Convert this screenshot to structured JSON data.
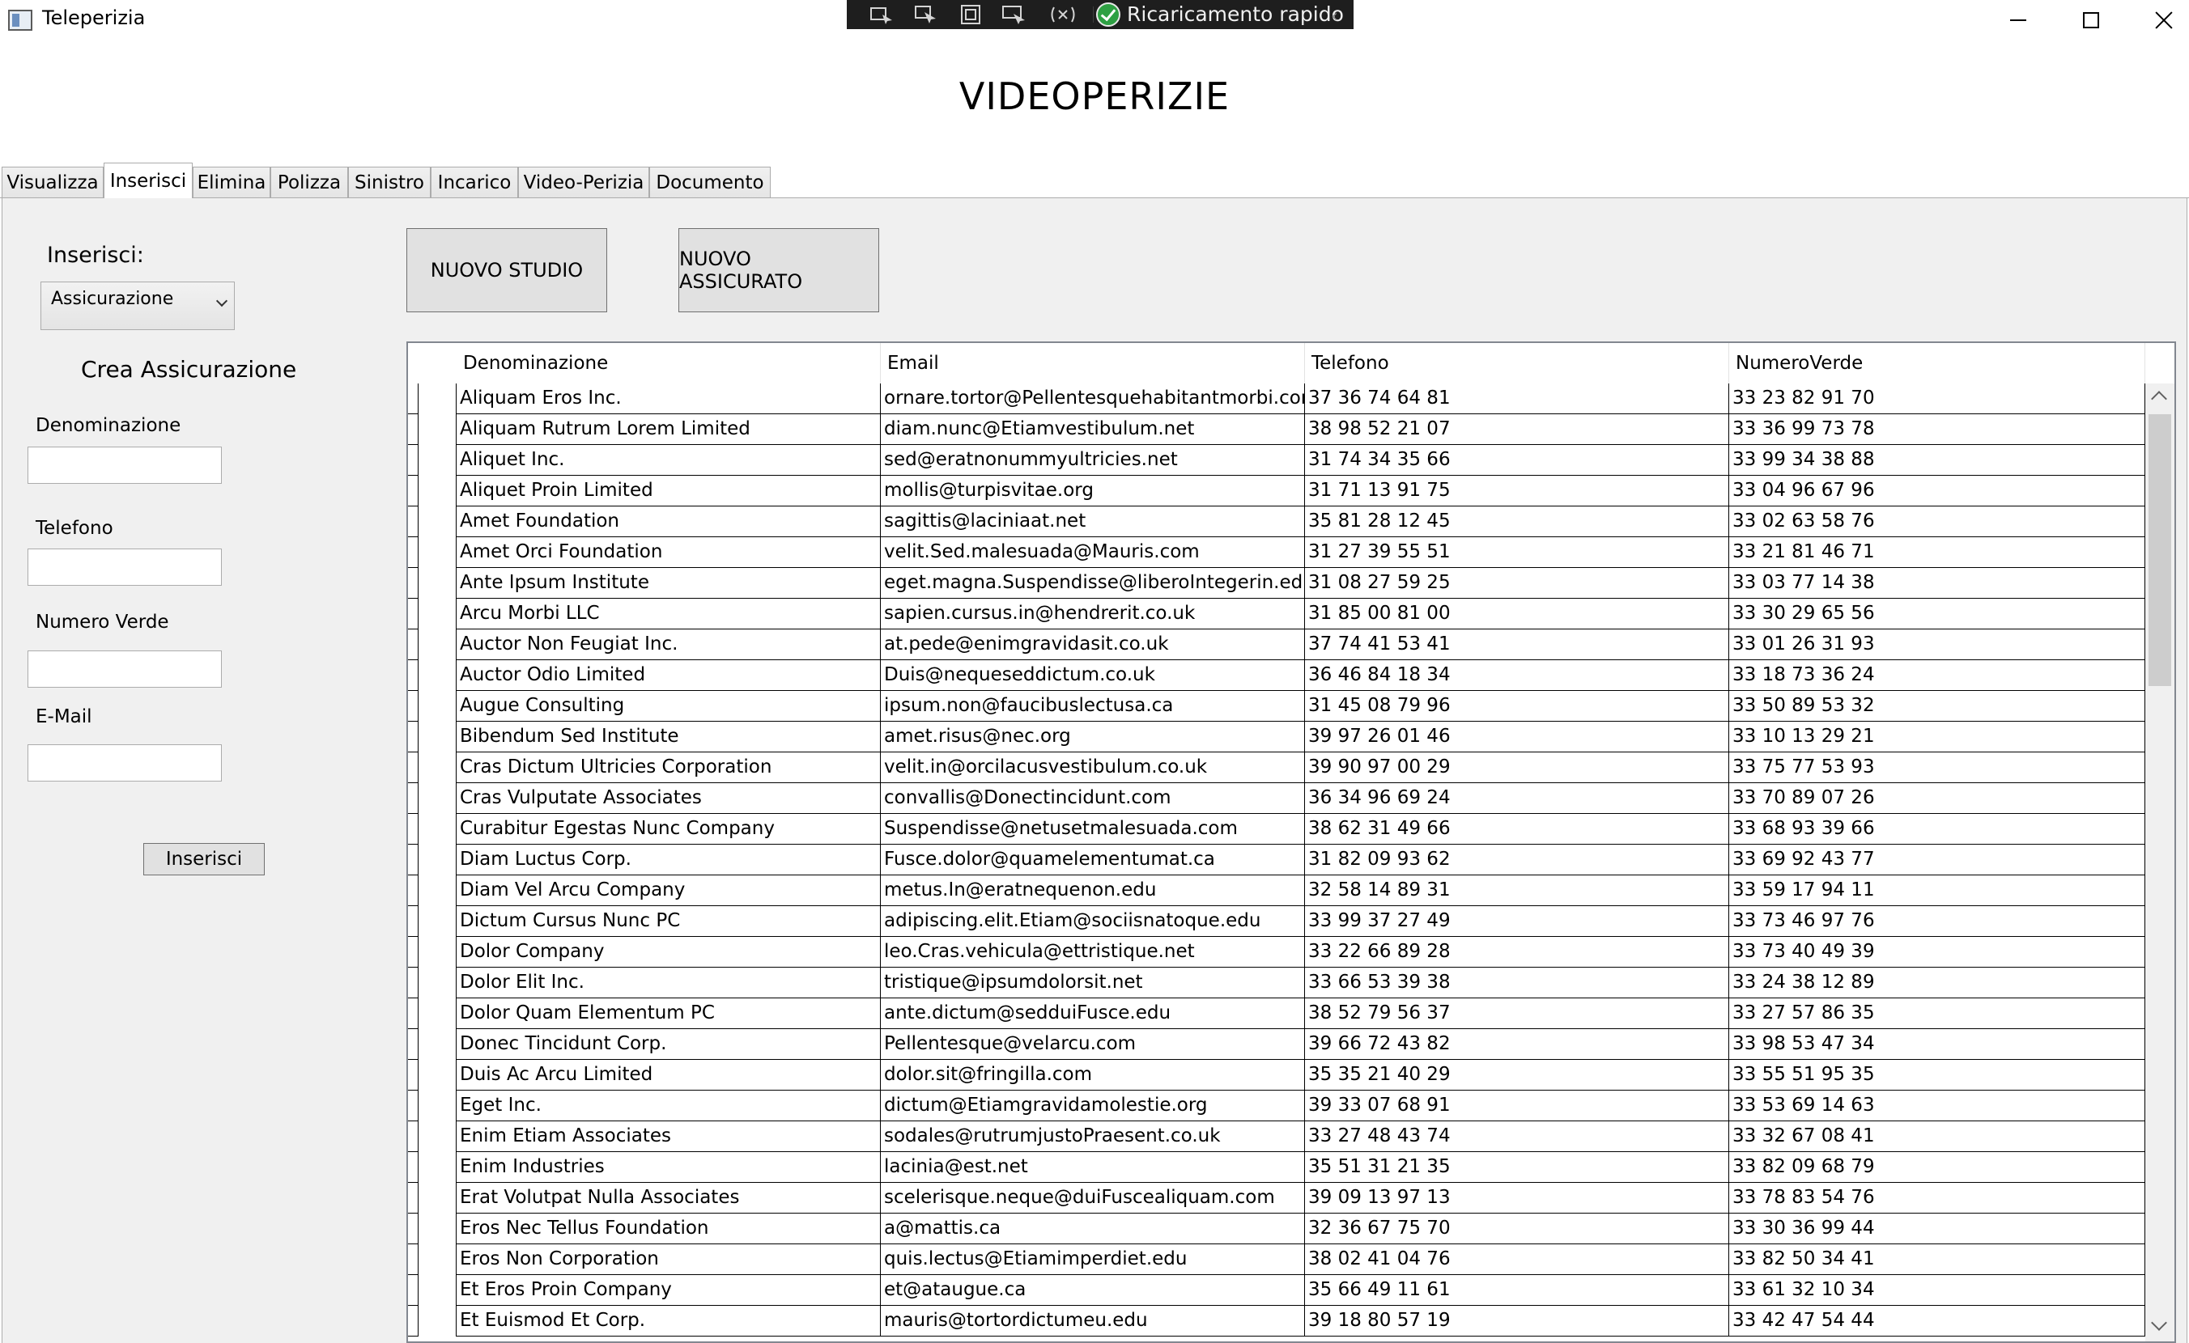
{
  "window": {
    "title": "Teleperizia"
  },
  "debug_toolbar": {
    "hot_reload_label": "Ricaricamento rapido"
  },
  "page": {
    "heading": "VIDEOPERIZIE"
  },
  "tabs": [
    {
      "label": "Visualizza",
      "active": false
    },
    {
      "label": "Inserisci",
      "active": true
    },
    {
      "label": "Elimina",
      "active": false
    },
    {
      "label": "Polizza",
      "active": false
    },
    {
      "label": "Sinistro",
      "active": false
    },
    {
      "label": "Incarico",
      "active": false
    },
    {
      "label": "Video-Perizia",
      "active": false
    },
    {
      "label": "Documento",
      "active": false
    }
  ],
  "form": {
    "insert_label": "Inserisci:",
    "entity_select_value": "Assicurazione",
    "title": "Crea Assicurazione",
    "fields": {
      "denominazione": {
        "label": "Denominazione",
        "value": ""
      },
      "telefono": {
        "label": "Telefono",
        "value": ""
      },
      "numero_verde": {
        "label": "Numero Verde",
        "value": ""
      },
      "email": {
        "label": "E-Mail",
        "value": ""
      }
    },
    "submit_label": "Inserisci"
  },
  "actions": {
    "new_studio": "NUOVO STUDIO",
    "new_assicurato": "NUOVO ASSICURATO"
  },
  "table": {
    "columns": [
      "Denominazione",
      "Email",
      "Telefono",
      "NumeroVerde"
    ],
    "rows": [
      [
        "Aliquam Eros Inc.",
        "ornare.tortor@Pellentesquehabitantmorbi.com",
        "37 36 74 64 81",
        "33 23 82 91 70"
      ],
      [
        "Aliquam Rutrum Lorem Limited",
        "diam.nunc@Etiamvestibulum.net",
        "38 98 52 21 07",
        "33 36 99 73 78"
      ],
      [
        "Aliquet Inc.",
        "sed@eratnonummyultricies.net",
        "31 74 34 35 66",
        "33 99 34 38 88"
      ],
      [
        "Aliquet Proin Limited",
        "mollis@turpisvitae.org",
        "31 71 13 91 75",
        "33 04 96 67 96"
      ],
      [
        "Amet Foundation",
        "sagittis@laciniaat.net",
        "35 81 28 12 45",
        "33 02 63 58 76"
      ],
      [
        "Amet Orci Foundation",
        "velit.Sed.malesuada@Mauris.com",
        "31 27 39 55 51",
        "33 21 81 46 71"
      ],
      [
        "Ante Ipsum Institute",
        "eget.magna.Suspendisse@liberoIntegerin.edu",
        "31 08 27 59 25",
        "33 03 77 14 38"
      ],
      [
        "Arcu Morbi LLC",
        "sapien.cursus.in@hendrerit.co.uk",
        "31 85 00 81 00",
        "33 30 29 65 56"
      ],
      [
        "Auctor Non Feugiat Inc.",
        "at.pede@enimgravidasit.co.uk",
        "37 74 41 53 41",
        "33 01 26 31 93"
      ],
      [
        "Auctor Odio Limited",
        "Duis@nequeseddictum.co.uk",
        "36 46 84 18 34",
        "33 18 73 36 24"
      ],
      [
        "Augue Consulting",
        "ipsum.non@faucibuslectusa.ca",
        "31 45 08 79 96",
        "33 50 89 53 32"
      ],
      [
        "Bibendum Sed Institute",
        "amet.risus@nec.org",
        "39 97 26 01 46",
        "33 10 13 29 21"
      ],
      [
        "Cras Dictum Ultricies Corporation",
        "velit.in@orcilacusvestibulum.co.uk",
        "39 90 97 00 29",
        "33 75 77 53 93"
      ],
      [
        "Cras Vulputate Associates",
        "convallis@Donectincidunt.com",
        "36 34 96 69 24",
        "33 70 89 07 26"
      ],
      [
        "Curabitur Egestas Nunc Company",
        "Suspendisse@netusetmalesuada.com",
        "38 62 31 49 66",
        "33 68 93 39 66"
      ],
      [
        "Diam Luctus Corp.",
        "Fusce.dolor@quamelementumat.ca",
        "31 82 09 93 62",
        "33 69 92 43 77"
      ],
      [
        "Diam Vel Arcu Company",
        "metus.In@eratnequenon.edu",
        "32 58 14 89 31",
        "33 59 17 94 11"
      ],
      [
        "Dictum Cursus Nunc PC",
        "adipiscing.elit.Etiam@sociisnatoque.edu",
        "33 99 37 27 49",
        "33 73 46 97 76"
      ],
      [
        "Dolor Company",
        "leo.Cras.vehicula@ettristique.net",
        "33 22 66 89 28",
        "33 73 40 49 39"
      ],
      [
        "Dolor Elit Inc.",
        "tristique@ipsumdolorsit.net",
        "33 66 53 39 38",
        "33 24 38 12 89"
      ],
      [
        "Dolor Quam Elementum PC",
        "ante.dictum@sedduiFusce.edu",
        "38 52 79 56 37",
        "33 27 57 86 35"
      ],
      [
        "Donec Tincidunt Corp.",
        "Pellentesque@velarcu.com",
        "39 66 72 43 82",
        "33 98 53 47 34"
      ],
      [
        "Duis Ac Arcu Limited",
        "dolor.sit@fringilla.com",
        "35 35 21 40 29",
        "33 55 51 95 35"
      ],
      [
        "Eget Inc.",
        "dictum@Etiamgravidamolestie.org",
        "39 33 07 68 91",
        "33 53 69 14 63"
      ],
      [
        "Enim Etiam Associates",
        "sodales@rutrumjustoPraesent.co.uk",
        "33 27 48 43 74",
        "33 32 67 08 41"
      ],
      [
        "Enim Industries",
        "lacinia@est.net",
        "35 51 31 21 35",
        "33 82 09 68 79"
      ],
      [
        "Erat Volutpat Nulla Associates",
        "scelerisque.neque@duiFuscealiquam.com",
        "39 09 13 97 13",
        "33 78 83 54 76"
      ],
      [
        "Eros Nec Tellus Foundation",
        "a@mattis.ca",
        "32 36 67 75 70",
        "33 30 36 99 44"
      ],
      [
        "Eros Non Corporation",
        "quis.lectus@Etiamimperdiet.edu",
        "38 02 41 04 76",
        "33 82 50 34 41"
      ],
      [
        "Et Eros Proin Company",
        "et@ataugue.ca",
        "35 66 49 11 61",
        "33 61 32 10 34"
      ],
      [
        "Et Euismod Et Corp.",
        "mauris@tortordictumeu.edu",
        "39 18 80 57 19",
        "33 42 47 54 44"
      ]
    ]
  }
}
